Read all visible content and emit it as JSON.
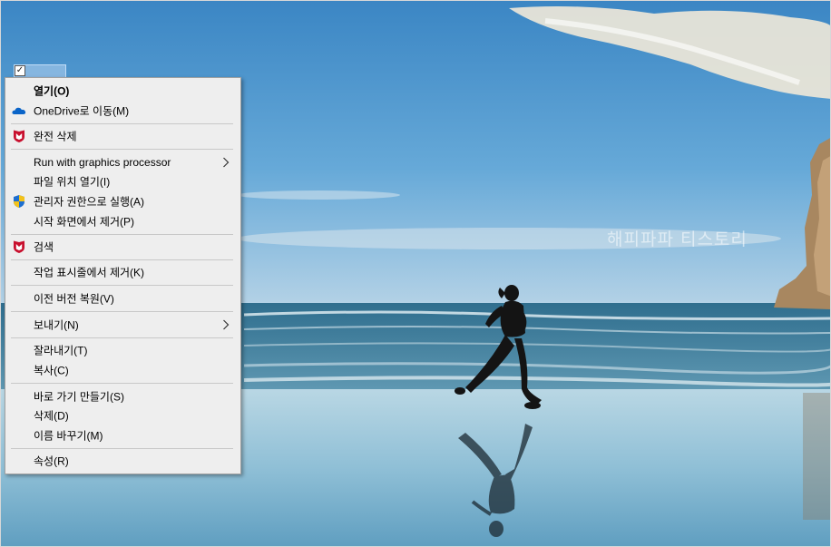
{
  "watermark": "해피파파 티스토리",
  "desktop": {
    "checkbox_mark": "✓"
  },
  "context_menu": {
    "open": "열기(O)",
    "move_onedrive": "OneDrive로 이동(M)",
    "permanent_delete": "완전 삭제",
    "run_gpu": "Run with graphics processor",
    "open_location": "파일 위치 열기(I)",
    "run_as_admin": "관리자 권한으로 실행(A)",
    "remove_start": "시작 화면에서 제거(P)",
    "search": "검색",
    "remove_taskbar": "작업 표시줄에서 제거(K)",
    "restore_versions": "이전 버전 복원(V)",
    "send_to": "보내기(N)",
    "cut": "잘라내기(T)",
    "copy": "복사(C)",
    "create_shortcut": "바로 가기 만들기(S)",
    "delete": "삭제(D)",
    "rename": "이름 바꾸기(M)",
    "properties": "속성(R)"
  },
  "icons": {
    "onedrive": "cloud-icon",
    "mcafee_1": "mcafee-shield-icon",
    "admin": "uac-shield-icon",
    "mcafee_2": "mcafee-shield-icon",
    "submenu": "chevron-right-icon"
  },
  "colors": {
    "menu_bg": "#eeeeee",
    "mcafee_red": "#c8102e",
    "onedrive_blue": "#0a64c8"
  }
}
